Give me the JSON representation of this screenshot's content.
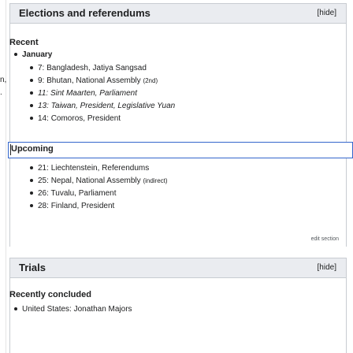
{
  "left_fragments": [
    "n,",
    "."
  ],
  "elections": {
    "title": "Elections and referendums",
    "toggle": "[hide]",
    "recent_label": "Recent",
    "month": "January",
    "recent_items": [
      {
        "date": "7:",
        "place": "Bangladesh",
        "desc": ", Jatiya Sangsad",
        "italic": false,
        "note": ""
      },
      {
        "date": "9:",
        "place": "Bhutan",
        "desc": ", National Assembly",
        "italic": false,
        "note": "(2nd)"
      },
      {
        "date": "11:",
        "place": "Sint Maarten",
        "desc": ", Parliament",
        "italic": true,
        "note": ""
      },
      {
        "date": "13:",
        "place": "Taiwan",
        "desc": ", President, Legislative Yuan",
        "italic": true,
        "note": ""
      },
      {
        "date": "14:",
        "place": "Comoros",
        "desc": ", President",
        "italic": false,
        "note": ""
      }
    ],
    "upcoming_label": "Upcoming",
    "upcoming_items": [
      {
        "date": "21:",
        "place": "Liechtenstein",
        "desc": ", Referendums",
        "note": ""
      },
      {
        "date": "25:",
        "place": "Nepal",
        "desc": ", National Assembly",
        "note": "(indirect)"
      },
      {
        "date": "26:",
        "place": "Tuvalu",
        "desc": ", Parliament",
        "note": ""
      },
      {
        "date": "28:",
        "place": "Finland",
        "desc": ", President",
        "note": ""
      }
    ],
    "edit_section": "edit section"
  },
  "trials": {
    "title": "Trials",
    "toggle": "[hide]",
    "recently_concluded_label": "Recently concluded",
    "items": [
      {
        "place": "United States",
        "desc": ": Jonathan Majors"
      }
    ]
  }
}
